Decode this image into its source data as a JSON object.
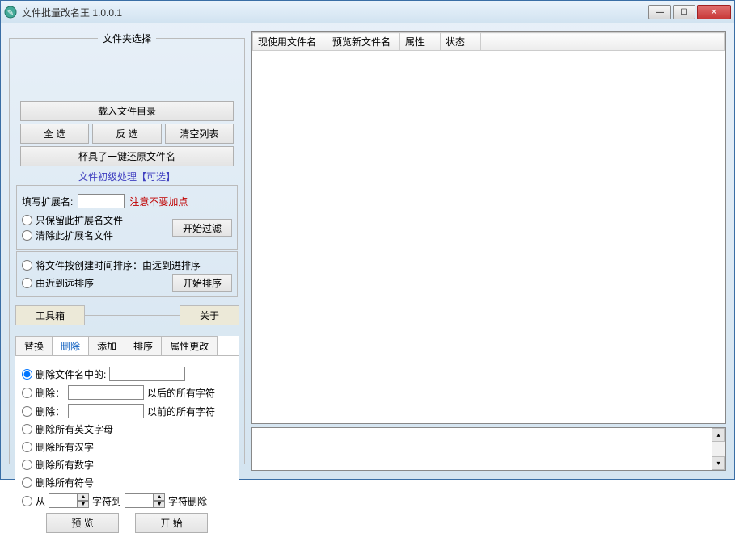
{
  "window": {
    "title": "文件批量改名王  1.0.0.1"
  },
  "folder": {
    "legend": "文件夹选择",
    "load_dir": "载入文件目录",
    "select_all": "全 选",
    "invert": "反 选",
    "clear": "清空列表",
    "restore": "杯具了一键还原文件名"
  },
  "preprocess": {
    "label": "文件初级处理【可选】",
    "ext_label": "填写扩展名:",
    "ext_warn": "注意不要加点",
    "keep_ext": "只保留此扩展名文件",
    "remove_ext": "清除此扩展名文件",
    "start_filter": "开始过滤",
    "sort_asc": "将文件按创建时间排序：由远到进排序",
    "sort_desc": "由近到远排序",
    "start_sort": "开始排序"
  },
  "tabs": {
    "toolbox": "工具箱",
    "about": "关于",
    "replace": "替换",
    "delete": "删除",
    "add": "添加",
    "sort": "排序",
    "attr": "属性更改"
  },
  "delete_tab": {
    "r1": "删除文件名中的:",
    "r2_pre": "删除：",
    "r2_post": "以后的所有字符",
    "r3_pre": "删除：",
    "r3_post": "以前的所有字符",
    "r4": "删除所有英文字母",
    "r5": "删除所有汉字",
    "r6": "删除所有数字",
    "r7": "删除所有符号",
    "r8_from": "从",
    "r8_mid": "字符到",
    "r8_end": "字符删除",
    "preview": "预 览",
    "start": "开 始"
  },
  "table": {
    "col1": "现使用文件名",
    "col2": "预览新文件名",
    "col3": "属性",
    "col4": "状态"
  }
}
